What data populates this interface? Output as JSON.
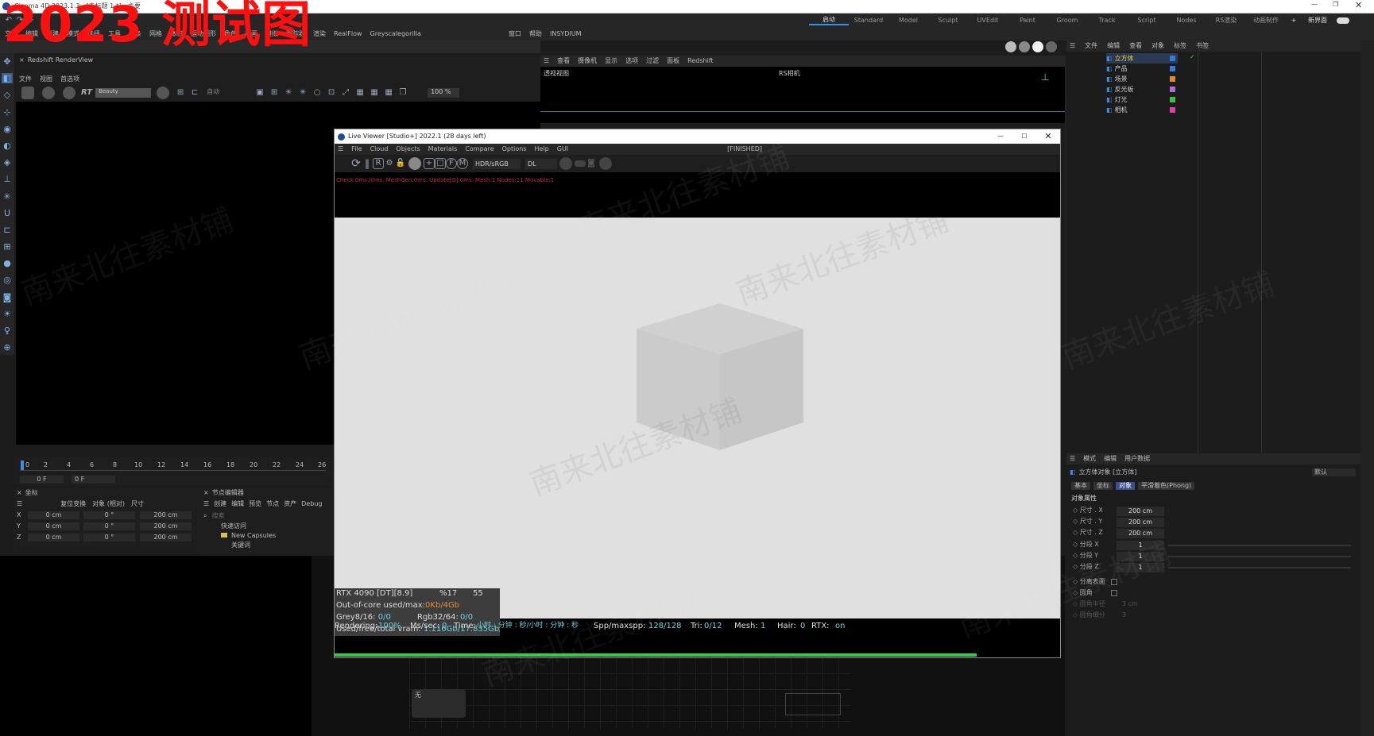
{
  "app": {
    "title": "Cinema 4D 2023.1.3 - [未标题 1 *] - 主要",
    "watermark_big": "2023 测试图",
    "watermark_text": "南来北往素材铺"
  },
  "menubar": {
    "items": [
      "文件",
      "编辑",
      "创建",
      "模式",
      "选择",
      "工具",
      "样条",
      "网格",
      "体积",
      "运动图形",
      "角色",
      "动画",
      "模拟",
      "跟踪器",
      "渲染",
      "RealFlow",
      "Greyscalegorilla",
      "窗口",
      "帮助",
      "INSYDIUM"
    ]
  },
  "layouts": {
    "items": [
      "启动",
      "Standard",
      "Model",
      "Sculpt",
      "UVEdit",
      "Paint",
      "Groom",
      "Track",
      "Script",
      "Nodes",
      "RS渲染",
      "动画制作"
    ],
    "new_label": "新界面"
  },
  "renderview": {
    "title": "Redshift RenderView",
    "menu": [
      "文件",
      "视图",
      "首选项"
    ],
    "rt_label": "RT",
    "aov": "Beauty",
    "auto": "自动",
    "zoom": "100 %"
  },
  "viewport": {
    "menu": [
      "查看",
      "摄像机",
      "显示",
      "选项",
      "过滤",
      "面板",
      "Redshift"
    ],
    "label": "透视视图",
    "camera": "RS相机"
  },
  "timeline": {
    "ticks": [
      "0",
      "2",
      "4",
      "6",
      "8",
      "10",
      "12",
      "14",
      "16",
      "18",
      "20",
      "22",
      "24",
      "26"
    ],
    "frame_a": "0 F",
    "frame_b": "0 F"
  },
  "coords": {
    "title": "坐标",
    "modes": [
      "复位变换",
      "对象 (相对)",
      "尺寸"
    ],
    "rows": [
      {
        "axis": "X",
        "pos": "0 cm",
        "rot": "0 °",
        "size": "200 cm"
      },
      {
        "axis": "Y",
        "pos": "0 cm",
        "rot": "0 °",
        "size": "200 cm"
      },
      {
        "axis": "Z",
        "pos": "0 cm",
        "rot": "0 °",
        "size": "200 cm"
      }
    ]
  },
  "nodes": {
    "title": "节点编辑器",
    "menu": [
      "创建",
      "编辑",
      "预览",
      "节点",
      "资产",
      "Debug"
    ],
    "search_placeholder": "搜索",
    "tree": [
      "快速访问",
      "New Capsules",
      "关键词"
    ],
    "node_label": "无"
  },
  "live_viewer": {
    "title": "Live Viewer [Studio+] 2022.1 (28 days left)",
    "menu": [
      "File",
      "Cloud",
      "Objects",
      "Materials",
      "Compare",
      "Options",
      "Help",
      "GUI"
    ],
    "status": "[FINISHED]",
    "color_space": "HDR/sRGB",
    "kernel": "DL",
    "check_line": "Check:0ms./0ms. MeshGen:0ms. Update[G]:0ms. Mesh:1 Nodes:11 Movable:1",
    "gpu": {
      "name": "RTX 4090 [DT][8.9]",
      "util": "%17",
      "temp": "55"
    },
    "out_of_core": {
      "label": "Out-of-core used/max:",
      "value": "0Kb/4Gb"
    },
    "grey": {
      "label": "Grey8/16:",
      "value": "0/0",
      "rgb_label": "Rgb32/64:",
      "rgb_value": "0/0"
    },
    "vram": {
      "label": "Used/free/total vram:",
      "value": "1.116Gb/17.835Gb/2"
    },
    "render": {
      "rendering_label": "Rendering:",
      "rendering_value": "100%",
      "ms_label": "Ms/sec:",
      "ms_value": "0",
      "time_label": "Time:",
      "time_value": "小时 : 分钟 : 秒/小时 : 分钟 : 秒",
      "spp_label": "Spp/maxspp:",
      "spp_value": "128/128",
      "tri_label": "Tri:",
      "tri_value": "0/12",
      "mesh_label": "Mesh:",
      "mesh_value": "1",
      "hair_label": "Hair:",
      "hair_value": "0",
      "rtx_label": "RTX:",
      "rtx_value": "on"
    },
    "progress": 100
  },
  "objects": {
    "menu": [
      "文件",
      "编辑",
      "查看",
      "对象",
      "标签",
      "书签"
    ],
    "items": [
      {
        "name": "立方体",
        "color": "#2f7de0",
        "highlight": true
      },
      {
        "name": "产品",
        "color": "#2f7de0",
        "highlight": false
      },
      {
        "name": "场景",
        "color": "#e08a2f",
        "highlight": false
      },
      {
        "name": "反光板",
        "color": "#b070d0",
        "highlight": false
      },
      {
        "name": "灯光",
        "color": "#40c040",
        "highlight": false
      },
      {
        "name": "相机",
        "color": "#e040a0",
        "highlight": false
      }
    ]
  },
  "attributes": {
    "menu": [
      "模式",
      "编辑",
      "用户数据"
    ],
    "object_title": "立方体对象 [立方体]",
    "preset": "默认",
    "tabs": [
      "基本",
      "坐标",
      "对象",
      "平滑着色(Phong)"
    ],
    "active_tab": "对象",
    "section": "对象属性",
    "fields": [
      {
        "label": "尺寸 . X",
        "value": "200 cm"
      },
      {
        "label": "尺寸 . Y",
        "value": "200 cm"
      },
      {
        "label": "尺寸 . Z",
        "value": "200 cm"
      },
      {
        "label": "分段 X",
        "value": "1"
      },
      {
        "label": "分段 Y",
        "value": "1"
      },
      {
        "label": "分段 Z",
        "value": "1"
      }
    ],
    "checks": [
      "分离表面",
      "圆角"
    ],
    "dim_fields": [
      {
        "label": "圆角半径",
        "value": "3 cm"
      },
      {
        "label": "圆角细分",
        "value": "3"
      }
    ]
  },
  "colors": {
    "accent": "#3c8ee0",
    "progress": "#2fcf3f",
    "cyan": "#6ad3e0"
  }
}
